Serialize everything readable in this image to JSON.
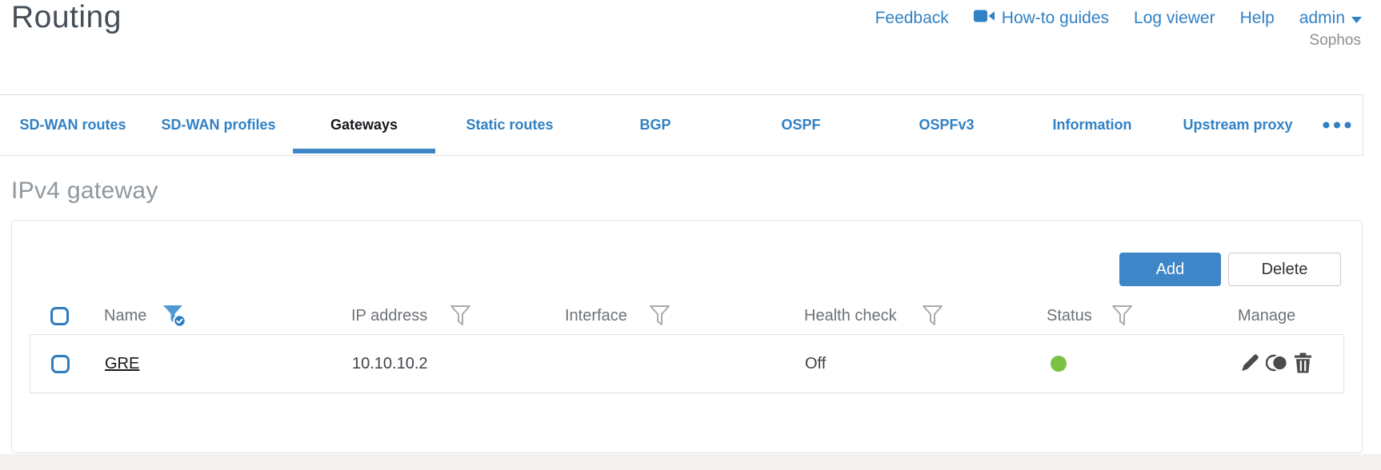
{
  "page": {
    "title": "Routing"
  },
  "header": {
    "links": [
      {
        "label": "Feedback"
      },
      {
        "label": "How-to guides",
        "icon": "video-camera"
      },
      {
        "label": "Log viewer"
      },
      {
        "label": "Help"
      },
      {
        "label": "admin",
        "icon": "caret-down"
      }
    ],
    "account": "Sophos"
  },
  "tabs": {
    "items": [
      {
        "label": "SD-WAN routes",
        "active": false
      },
      {
        "label": "SD-WAN profiles",
        "active": false
      },
      {
        "label": "Gateways",
        "active": true
      },
      {
        "label": "Static routes",
        "active": false
      },
      {
        "label": "BGP",
        "active": false
      },
      {
        "label": "OSPF",
        "active": false
      },
      {
        "label": "OSPFv3",
        "active": false
      },
      {
        "label": "Information",
        "active": false
      },
      {
        "label": "Upstream proxy",
        "active": false
      }
    ],
    "more_icon": "ellipsis"
  },
  "section": {
    "title": "IPv4 gateway"
  },
  "toolbar": {
    "add_label": "Add",
    "delete_label": "Delete"
  },
  "table": {
    "columns": [
      {
        "label": "Name",
        "filter": "active"
      },
      {
        "label": "IP address",
        "filter": "default"
      },
      {
        "label": "Interface",
        "filter": "default"
      },
      {
        "label": "Health check",
        "filter": "default"
      },
      {
        "label": "Status",
        "filter": "default"
      },
      {
        "label": "Manage",
        "filter": "none"
      }
    ],
    "rows": [
      {
        "name": "GRE",
        "ip": "10.10.10.2",
        "interface": "",
        "health_check": "Off",
        "status": "up",
        "actions": [
          "edit",
          "clone",
          "delete"
        ]
      }
    ]
  },
  "colors": {
    "accent_blue": "#3181c4",
    "button_blue": "#3e86c7",
    "status_green": "#7bc143"
  }
}
